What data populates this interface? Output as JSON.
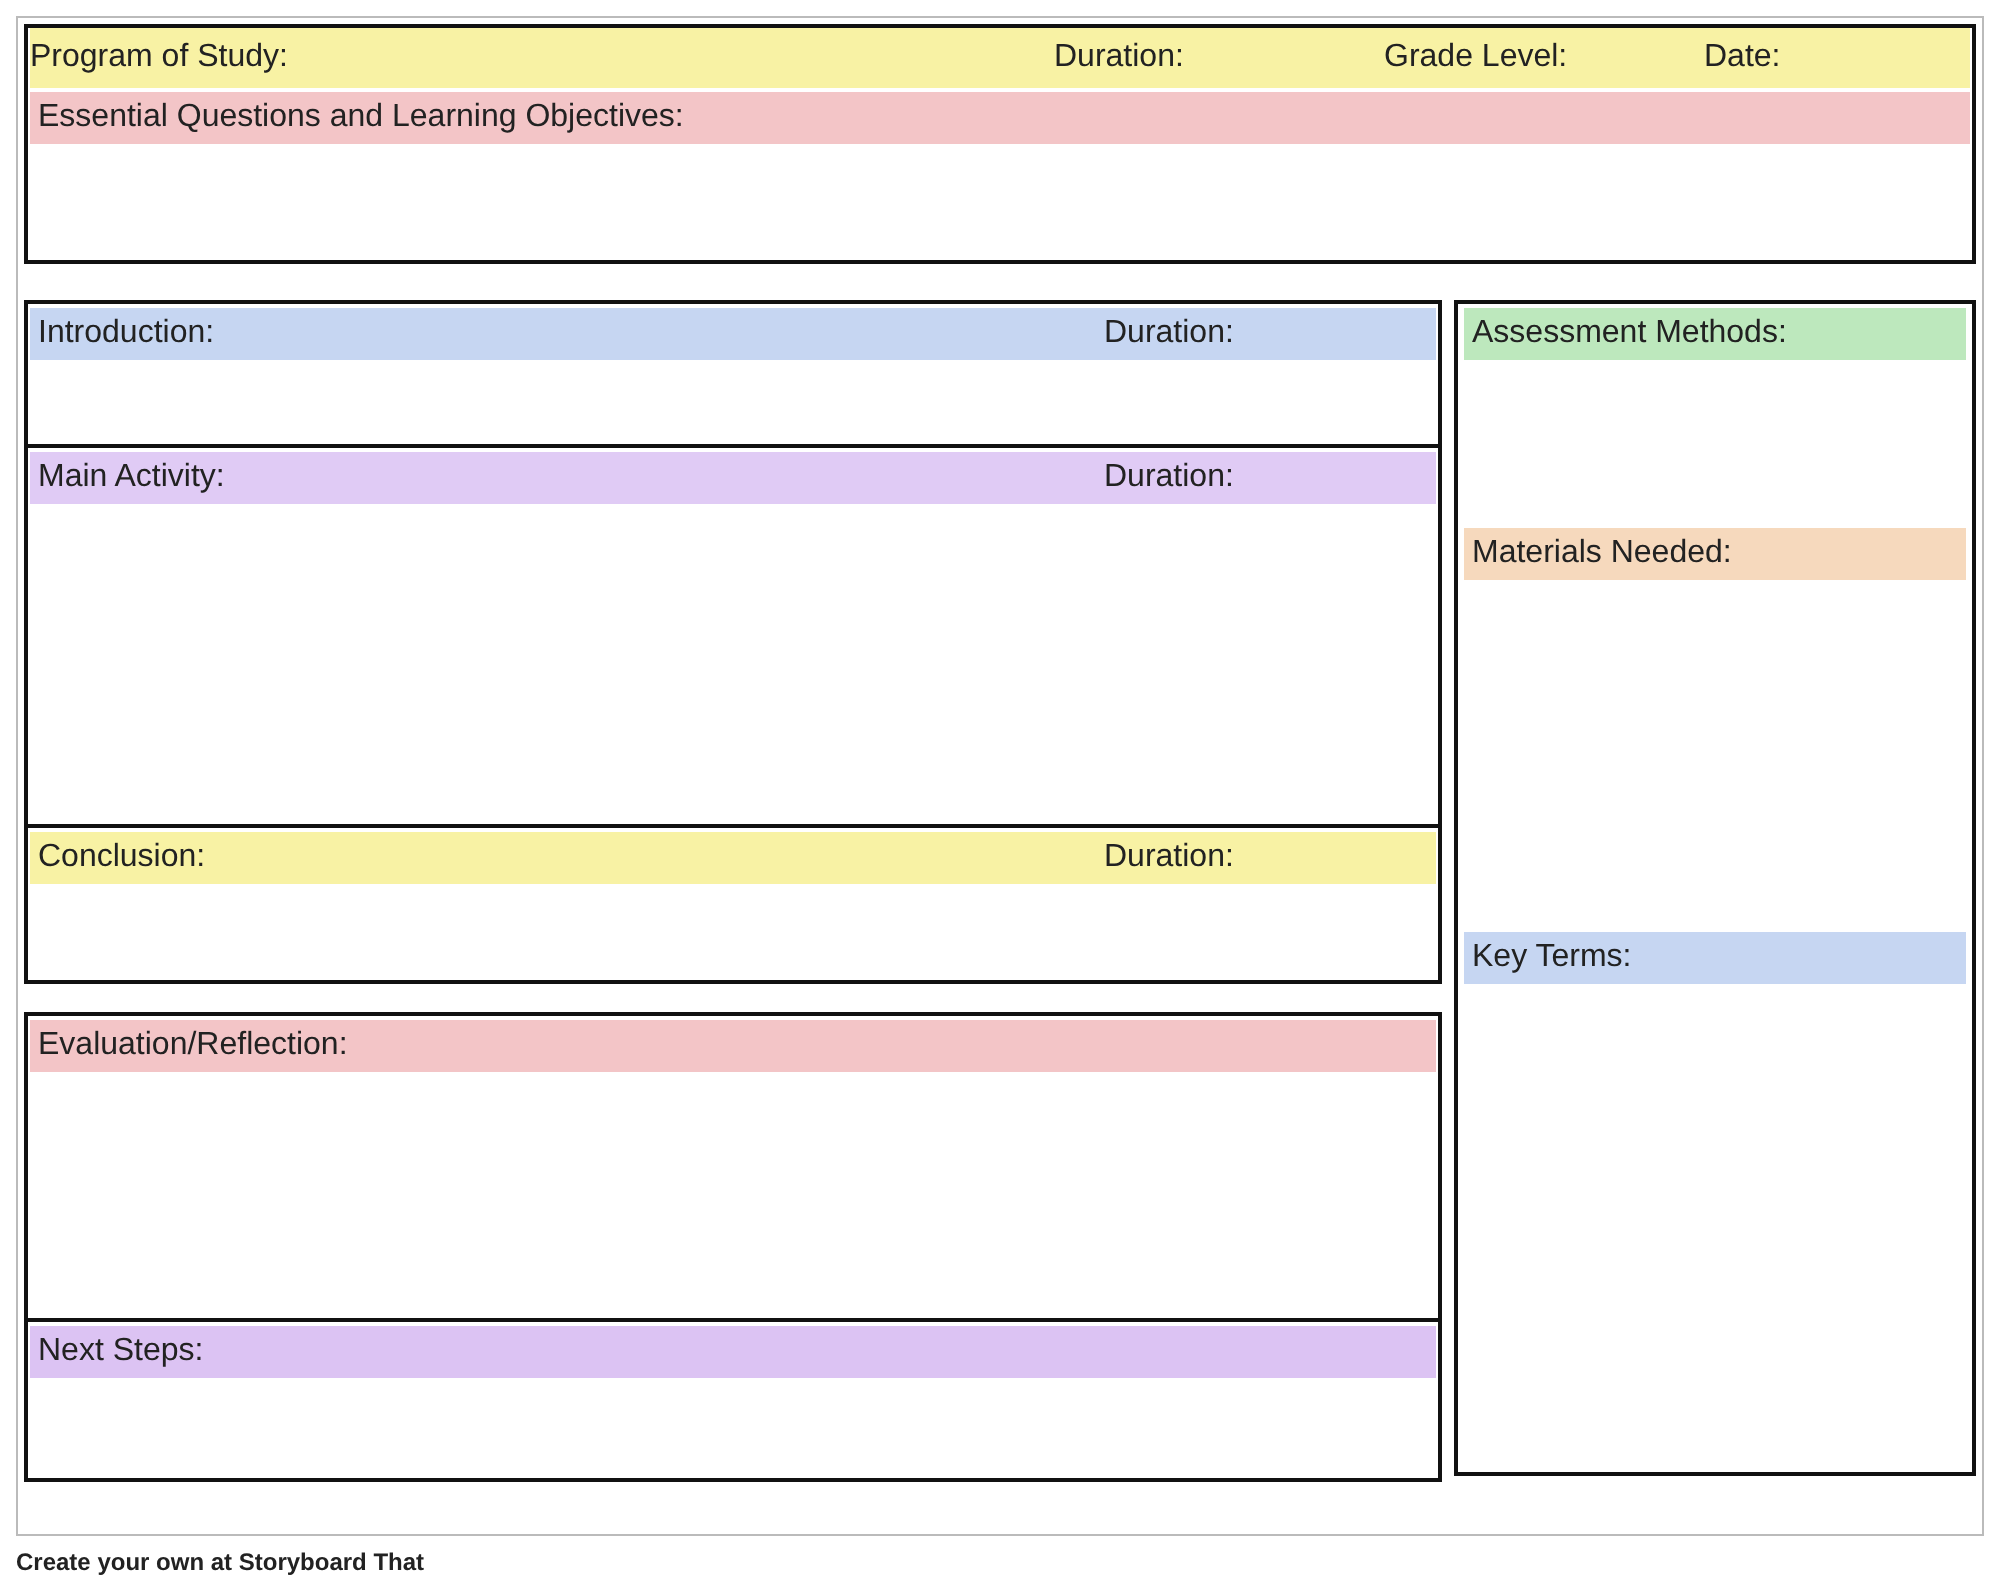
{
  "header": {
    "color": "#f8f2a4",
    "fields": [
      {
        "label": "Program of Study:"
      },
      {
        "label": "Duration:"
      },
      {
        "label": "Grade Level:"
      },
      {
        "label": "Date:"
      }
    ]
  },
  "objectives": {
    "label": "Essential Questions and Learning Objectives:",
    "color": "#f3c5c7"
  },
  "lesson_sections": [
    {
      "label": "Introduction:",
      "duration": "Duration:",
      "color": "#c6d6f2"
    },
    {
      "label": "Main Activity:",
      "duration": "Duration:",
      "color": "#e0cbf5"
    },
    {
      "label": "Conclusion:",
      "duration": "Duration:",
      "color": "#f8f2a4"
    }
  ],
  "reflection_sections": [
    {
      "label": "Evaluation/Reflection:",
      "color": "#f3c5c7"
    },
    {
      "label": "Next Steps:",
      "color": "#dcc3f3"
    }
  ],
  "side_sections": [
    {
      "label": "Assessment Methods:",
      "color": "#bde8bd"
    },
    {
      "label": "Materials Needed:",
      "color": "#f6d9bd"
    },
    {
      "label": "Key Terms:",
      "color": "#c6d6f2"
    }
  ],
  "footer": "Create your own at Storyboard That"
}
